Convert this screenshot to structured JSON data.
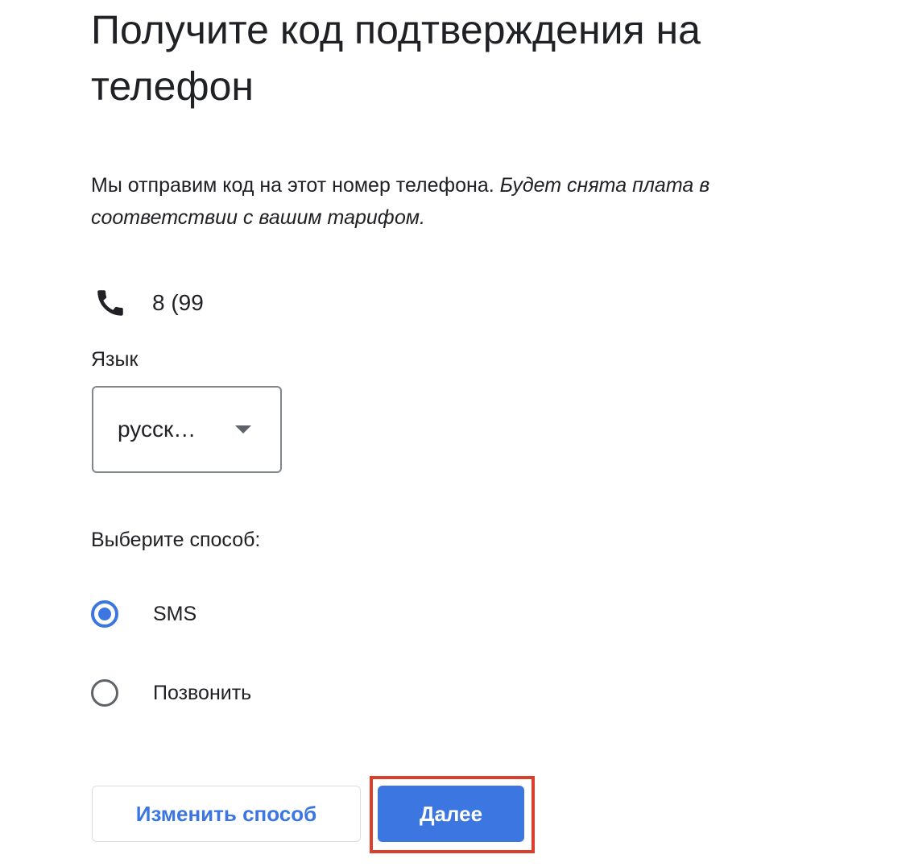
{
  "header": {
    "title": "Получите код подтверждения на телефон"
  },
  "description": {
    "text": "Мы отправим код на этот номер телефона. ",
    "note": "Будет снята плата в соответствии с вашим тарифом."
  },
  "phone": {
    "icon": "phone-icon",
    "number": "8 (99"
  },
  "language": {
    "label": "Язык",
    "selected": "русск…"
  },
  "method": {
    "label": "Выберите способ:",
    "options": [
      {
        "label": "SMS",
        "checked": true
      },
      {
        "label": "Позвонить",
        "checked": false
      }
    ]
  },
  "actions": {
    "change_label": "Изменить способ",
    "next_label": "Далее"
  },
  "colors": {
    "accent": "#3b76e1",
    "highlight": "#d93f2b",
    "text": "#202124"
  }
}
